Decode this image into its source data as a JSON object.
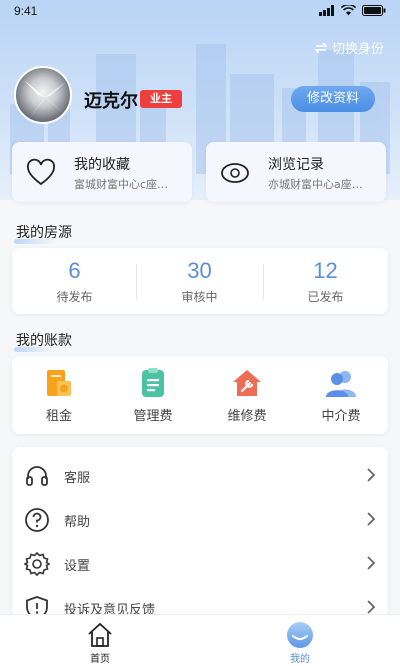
{
  "status_bar": {
    "time": "9:41"
  },
  "header": {
    "switch_identity": "切换身份"
  },
  "profile": {
    "name": "迈克尔",
    "role_badge": "业主",
    "edit_button": "修改资料"
  },
  "quick_cards": [
    {
      "title": "我的收藏",
      "subtitle": "富城财富中心c座…",
      "icon": "heart-icon"
    },
    {
      "title": "浏览记录",
      "subtitle": "亦城财富中心a座…",
      "icon": "eye-icon"
    }
  ],
  "listings": {
    "title": "我的房源",
    "stats": [
      {
        "value": "6",
        "label": "待发布"
      },
      {
        "value": "30",
        "label": "审核中"
      },
      {
        "value": "12",
        "label": "已发布"
      }
    ]
  },
  "account": {
    "title": "我的账款",
    "items": [
      {
        "label": "租金",
        "icon": "rent-icon",
        "color": "#f7a21b"
      },
      {
        "label": "管理费",
        "icon": "management-fee-icon",
        "color": "#4cc2a3"
      },
      {
        "label": "维修费",
        "icon": "repair-fee-icon",
        "color": "#f06d55"
      },
      {
        "label": "中介费",
        "icon": "agency-fee-icon",
        "color": "#5b8fe8"
      }
    ]
  },
  "menu": [
    {
      "label": "客服",
      "icon": "headset-icon"
    },
    {
      "label": "帮助",
      "icon": "help-icon"
    },
    {
      "label": "设置",
      "icon": "gear-icon"
    },
    {
      "label": "投诉及意见反馈",
      "icon": "shield-icon"
    }
  ],
  "tabbar": [
    {
      "label": "首页",
      "icon": "home-icon",
      "active": false
    },
    {
      "label": "我的",
      "icon": "profile-icon",
      "active": true
    }
  ],
  "colors": {
    "accent": "#5b8ed8",
    "badge": "#ee3f3f"
  }
}
